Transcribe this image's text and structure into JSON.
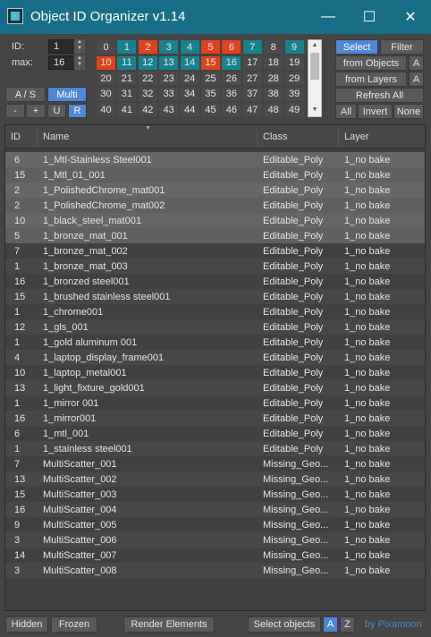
{
  "window": {
    "title": "Object ID Organizer  v1.14",
    "min": "—",
    "max": "☐",
    "close": "✕"
  },
  "controls": {
    "id_label": "ID:",
    "id_value": "1",
    "max_label": "max:",
    "max_value": "16",
    "as_label": "A / S",
    "multi_label": "Multi",
    "minus": "-",
    "plus": "+",
    "u": "U",
    "r": "R"
  },
  "id_grid": [
    [
      {
        "n": "0",
        "c": "#4a4a4a"
      },
      {
        "n": "1",
        "c": "#19828f"
      },
      {
        "n": "2",
        "c": "#e2421e"
      },
      {
        "n": "3",
        "c": "#19828f"
      },
      {
        "n": "4",
        "c": "#19828f"
      },
      {
        "n": "5",
        "c": "#e2421e"
      },
      {
        "n": "6",
        "c": "#e2421e"
      },
      {
        "n": "7",
        "c": "#19828f"
      },
      {
        "n": "8",
        "c": "#4a4a4a"
      },
      {
        "n": "9",
        "c": "#19828f"
      }
    ],
    [
      {
        "n": "10",
        "c": "#e2421e"
      },
      {
        "n": "11",
        "c": "#19828f"
      },
      {
        "n": "12",
        "c": "#19828f"
      },
      {
        "n": "13",
        "c": "#19828f"
      },
      {
        "n": "14",
        "c": "#19828f"
      },
      {
        "n": "15",
        "c": "#e2421e"
      },
      {
        "n": "16",
        "c": "#19828f"
      },
      {
        "n": "17",
        "c": "#4a4a4a"
      },
      {
        "n": "18",
        "c": "#4a4a4a"
      },
      {
        "n": "19",
        "c": "#4a4a4a"
      }
    ],
    [
      {
        "n": "20",
        "c": "#4a4a4a"
      },
      {
        "n": "21",
        "c": "#4a4a4a"
      },
      {
        "n": "22",
        "c": "#4a4a4a"
      },
      {
        "n": "23",
        "c": "#4a4a4a"
      },
      {
        "n": "24",
        "c": "#4a4a4a"
      },
      {
        "n": "25",
        "c": "#4a4a4a"
      },
      {
        "n": "26",
        "c": "#4a4a4a"
      },
      {
        "n": "27",
        "c": "#4a4a4a"
      },
      {
        "n": "28",
        "c": "#4a4a4a"
      },
      {
        "n": "29",
        "c": "#4a4a4a"
      }
    ],
    [
      {
        "n": "30",
        "c": "#4a4a4a"
      },
      {
        "n": "31",
        "c": "#4a4a4a"
      },
      {
        "n": "32",
        "c": "#4a4a4a"
      },
      {
        "n": "33",
        "c": "#4a4a4a"
      },
      {
        "n": "34",
        "c": "#4a4a4a"
      },
      {
        "n": "35",
        "c": "#4a4a4a"
      },
      {
        "n": "36",
        "c": "#4a4a4a"
      },
      {
        "n": "37",
        "c": "#4a4a4a"
      },
      {
        "n": "38",
        "c": "#4a4a4a"
      },
      {
        "n": "39",
        "c": "#4a4a4a"
      }
    ],
    [
      {
        "n": "40",
        "c": "#4a4a4a"
      },
      {
        "n": "41",
        "c": "#4a4a4a"
      },
      {
        "n": "42",
        "c": "#4a4a4a"
      },
      {
        "n": "43",
        "c": "#4a4a4a"
      },
      {
        "n": "44",
        "c": "#4a4a4a"
      },
      {
        "n": "45",
        "c": "#4a4a4a"
      },
      {
        "n": "46",
        "c": "#4a4a4a"
      },
      {
        "n": "47",
        "c": "#4a4a4a"
      },
      {
        "n": "48",
        "c": "#4a4a4a"
      },
      {
        "n": "49",
        "c": "#4a4a4a"
      }
    ]
  ],
  "right_panel": {
    "select": "Select",
    "filter": "Filter",
    "from_objects": "from Objects",
    "from_layers": "from Layers",
    "a": "A",
    "refresh_all": "Refresh All",
    "all": "All",
    "invert": "Invert",
    "none": "None"
  },
  "list": {
    "headers": {
      "id": "ID",
      "name": "Name",
      "class": "Class",
      "layer": "Layer"
    },
    "rows": [
      {
        "id": "6",
        "name": "1_Mtl-Stainless Steel001",
        "class": "Editable_Poly",
        "layer": "1_no bake",
        "sel": true
      },
      {
        "id": "15",
        "name": "1_Mtl_01_001",
        "class": "Editable_Poly",
        "layer": "1_no bake",
        "sel": true
      },
      {
        "id": "2",
        "name": "1_PolishedChrome_mat001",
        "class": "Editable_Poly",
        "layer": "1_no bake",
        "sel": true
      },
      {
        "id": "2",
        "name": "1_PolishedChrome_mat002",
        "class": "Editable_Poly",
        "layer": "1_no bake",
        "sel": true
      },
      {
        "id": "10",
        "name": "1_black_steel_mat001",
        "class": "Editable_Poly",
        "layer": "1_no bake",
        "sel": true
      },
      {
        "id": "5",
        "name": "1_bronze_mat_001",
        "class": "Editable_Poly",
        "layer": "1_no bake",
        "sel": true
      },
      {
        "id": "7",
        "name": "1_bronze_mat_002",
        "class": "Editable_Poly",
        "layer": "1_no bake",
        "sel": false
      },
      {
        "id": "1",
        "name": "1_bronze_mat_003",
        "class": "Editable_Poly",
        "layer": "1_no bake",
        "sel": false
      },
      {
        "id": "16",
        "name": "1_bronzed steel001",
        "class": "Editable_Poly",
        "layer": "1_no bake",
        "sel": false
      },
      {
        "id": "15",
        "name": "1_brushed stainless steel001",
        "class": "Editable_Poly",
        "layer": "1_no bake",
        "sel": false
      },
      {
        "id": "1",
        "name": "1_chrome001",
        "class": "Editable_Poly",
        "layer": "1_no bake",
        "sel": false
      },
      {
        "id": "12",
        "name": "1_gls_001",
        "class": "Editable_Poly",
        "layer": "1_no bake",
        "sel": false
      },
      {
        "id": "1",
        "name": "1_gold aluminum 001",
        "class": "Editable_Poly",
        "layer": "1_no bake",
        "sel": false
      },
      {
        "id": "4",
        "name": "1_laptop_display_frame001",
        "class": "Editable_Poly",
        "layer": "1_no bake",
        "sel": false
      },
      {
        "id": "10",
        "name": "1_laptop_metal001",
        "class": "Editable_Poly",
        "layer": "1_no bake",
        "sel": false
      },
      {
        "id": "13",
        "name": "1_light_fixture_gold001",
        "class": "Editable_Poly",
        "layer": "1_no bake",
        "sel": false
      },
      {
        "id": "1",
        "name": "1_mirror 001",
        "class": "Editable_Poly",
        "layer": "1_no bake",
        "sel": false
      },
      {
        "id": "16",
        "name": "1_mirror001",
        "class": "Editable_Poly",
        "layer": "1_no bake",
        "sel": false
      },
      {
        "id": "6",
        "name": "1_mtl_001",
        "class": "Editable_Poly",
        "layer": "1_no bake",
        "sel": false
      },
      {
        "id": "1",
        "name": "1_stainless steel001",
        "class": "Editable_Poly",
        "layer": "1_no bake",
        "sel": false
      },
      {
        "id": "7",
        "name": "MultiScatter_001",
        "class": "Missing_Geo...",
        "layer": "1_no bake",
        "sel": false
      },
      {
        "id": "13",
        "name": "MultiScatter_002",
        "class": "Missing_Geo...",
        "layer": "1_no bake",
        "sel": false
      },
      {
        "id": "15",
        "name": "MultiScatter_003",
        "class": "Missing_Geo...",
        "layer": "1_no bake",
        "sel": false
      },
      {
        "id": "16",
        "name": "MultiScatter_004",
        "class": "Missing_Geo...",
        "layer": "1_no bake",
        "sel": false
      },
      {
        "id": "9",
        "name": "MultiScatter_005",
        "class": "Missing_Geo...",
        "layer": "1_no bake",
        "sel": false
      },
      {
        "id": "3",
        "name": "MultiScatter_006",
        "class": "Missing_Geo...",
        "layer": "1_no bake",
        "sel": false
      },
      {
        "id": "14",
        "name": "MultiScatter_007",
        "class": "Missing_Geo...",
        "layer": "1_no bake",
        "sel": false
      },
      {
        "id": "3",
        "name": "MultiScatter_008",
        "class": "Missing_Geo...",
        "layer": "1_no bake",
        "sel": false
      }
    ]
  },
  "bottom": {
    "hidden": "Hidden",
    "frozen": "Frozen",
    "render_elements": "Render Elements",
    "select_objects": "Select objects",
    "a": "A",
    "z": "Z",
    "brand": "by Pixamoon"
  }
}
